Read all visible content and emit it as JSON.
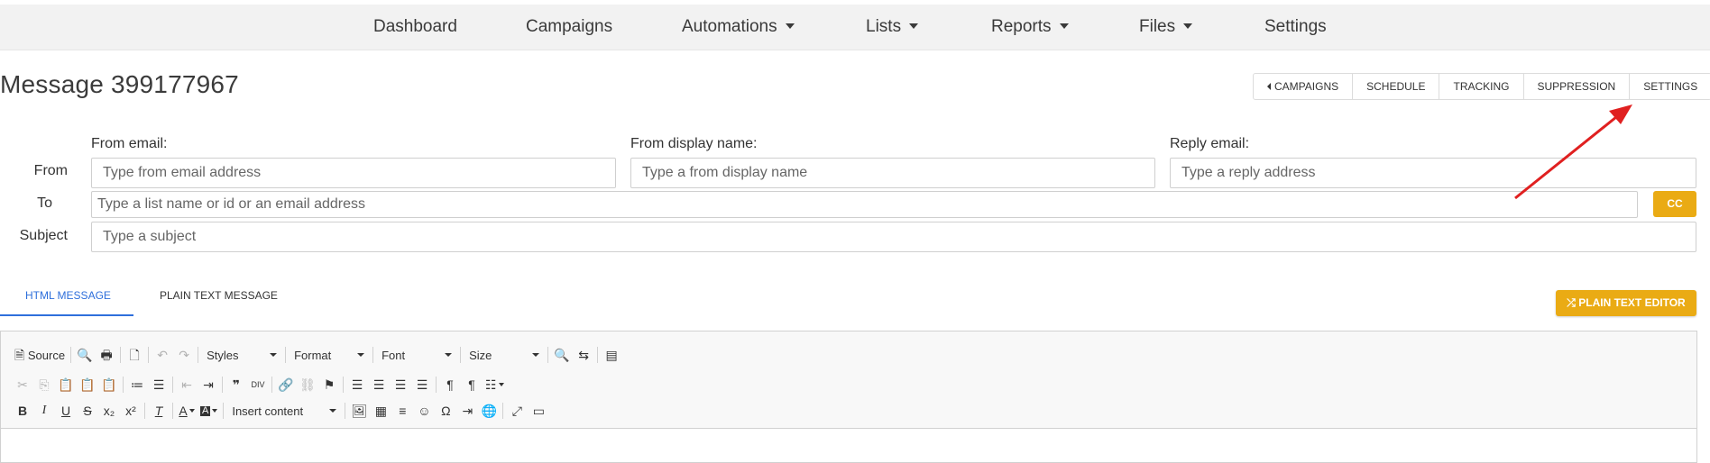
{
  "nav": {
    "items": [
      {
        "label": "Dashboard",
        "dropdown": false
      },
      {
        "label": "Campaigns",
        "dropdown": false
      },
      {
        "label": "Automations",
        "dropdown": true
      },
      {
        "label": "Lists",
        "dropdown": true
      },
      {
        "label": "Reports",
        "dropdown": true
      },
      {
        "label": "Files",
        "dropdown": true
      },
      {
        "label": "Settings",
        "dropdown": false
      }
    ]
  },
  "page": {
    "title": "Message 399177967"
  },
  "actions": {
    "campaigns": "CAMPAIGNS",
    "schedule": "SCHEDULE",
    "tracking": "TRACKING",
    "suppression": "SUPPRESSION",
    "settings": "SETTINGS"
  },
  "form": {
    "from_label": "From",
    "to_label": "To",
    "subject_label": "Subject",
    "from_email_label": "From email:",
    "from_email_placeholder": "Type from email address",
    "from_name_label": "From display name:",
    "from_name_placeholder": "Type a from display name",
    "reply_label": "Reply email:",
    "reply_placeholder": "Type a reply address",
    "to_placeholder": "Type a list name or id or an email address",
    "subject_placeholder": "Type a subject",
    "cc_label": "CC"
  },
  "tabs": {
    "html": "HTML MESSAGE",
    "plain": "PLAIN TEXT MESSAGE",
    "editor_btn": "PLAIN TEXT EDITOR"
  },
  "editor": {
    "source": "Source",
    "styles": "Styles",
    "format": "Format",
    "font": "Font",
    "size": "Size",
    "insert_content": "Insert content"
  },
  "colors": {
    "accent": "#eaab14",
    "tab_active": "#2e6fdb",
    "annotation_arrow": "#e02020"
  }
}
